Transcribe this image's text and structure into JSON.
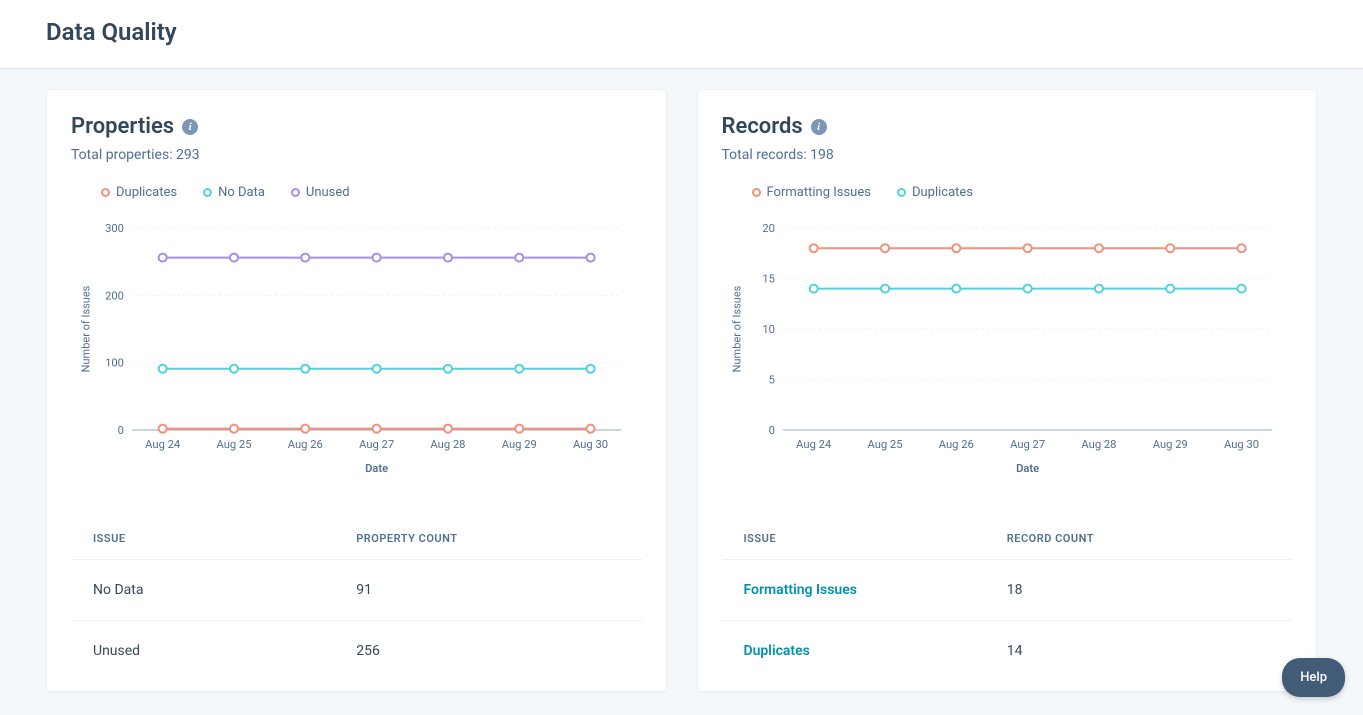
{
  "page_title": "Data Quality",
  "help_label": "Help",
  "properties_card": {
    "title": "Properties",
    "subtitle": "Total properties: 293",
    "legend": [
      {
        "label": "Duplicates",
        "color": "#f2917d"
      },
      {
        "label": "No Data",
        "color": "#51d3d9"
      },
      {
        "label": "Unused",
        "color": "#a78ee0"
      }
    ],
    "table": {
      "col1": "ISSUE",
      "col2": "PROPERTY COUNT",
      "rows": [
        {
          "label": "No Data",
          "value": "91",
          "link": false
        },
        {
          "label": "Unused",
          "value": "256",
          "link": false
        }
      ]
    }
  },
  "records_card": {
    "title": "Records",
    "subtitle": "Total records: 198",
    "legend": [
      {
        "label": "Formatting Issues",
        "color": "#f2917d"
      },
      {
        "label": "Duplicates",
        "color": "#51d3d9"
      }
    ],
    "table": {
      "col1": "ISSUE",
      "col2": "RECORD COUNT",
      "rows": [
        {
          "label": "Formatting Issues",
          "value": "18",
          "link": true
        },
        {
          "label": "Duplicates",
          "value": "14",
          "link": true
        }
      ]
    }
  },
  "chart_data": [
    {
      "id": "properties",
      "type": "line",
      "xlabel": "Date",
      "ylabel": "Number of Issues",
      "ylim": [
        0,
        300
      ],
      "yticks": [
        0,
        100,
        200,
        300
      ],
      "x": [
        "Aug 24",
        "Aug 25",
        "Aug 26",
        "Aug 27",
        "Aug 28",
        "Aug 29",
        "Aug 30"
      ],
      "series": [
        {
          "name": "Duplicates",
          "color": "#f2917d",
          "values": [
            2,
            2,
            2,
            2,
            2,
            2,
            2
          ]
        },
        {
          "name": "No Data",
          "color": "#51d3d9",
          "values": [
            91,
            91,
            91,
            91,
            91,
            91,
            91
          ]
        },
        {
          "name": "Unused",
          "color": "#a78ee0",
          "values": [
            256,
            256,
            256,
            256,
            256,
            256,
            256
          ]
        }
      ]
    },
    {
      "id": "records",
      "type": "line",
      "xlabel": "Date",
      "ylabel": "Number of Issues",
      "ylim": [
        0,
        20
      ],
      "yticks": [
        0,
        5,
        10,
        15,
        20
      ],
      "x": [
        "Aug 24",
        "Aug 25",
        "Aug 26",
        "Aug 27",
        "Aug 28",
        "Aug 29",
        "Aug 30"
      ],
      "series": [
        {
          "name": "Formatting Issues",
          "color": "#f2917d",
          "values": [
            18,
            18,
            18,
            18,
            18,
            18,
            18
          ]
        },
        {
          "name": "Duplicates",
          "color": "#51d3d9",
          "values": [
            14,
            14,
            14,
            14,
            14,
            14,
            14
          ]
        }
      ]
    }
  ]
}
